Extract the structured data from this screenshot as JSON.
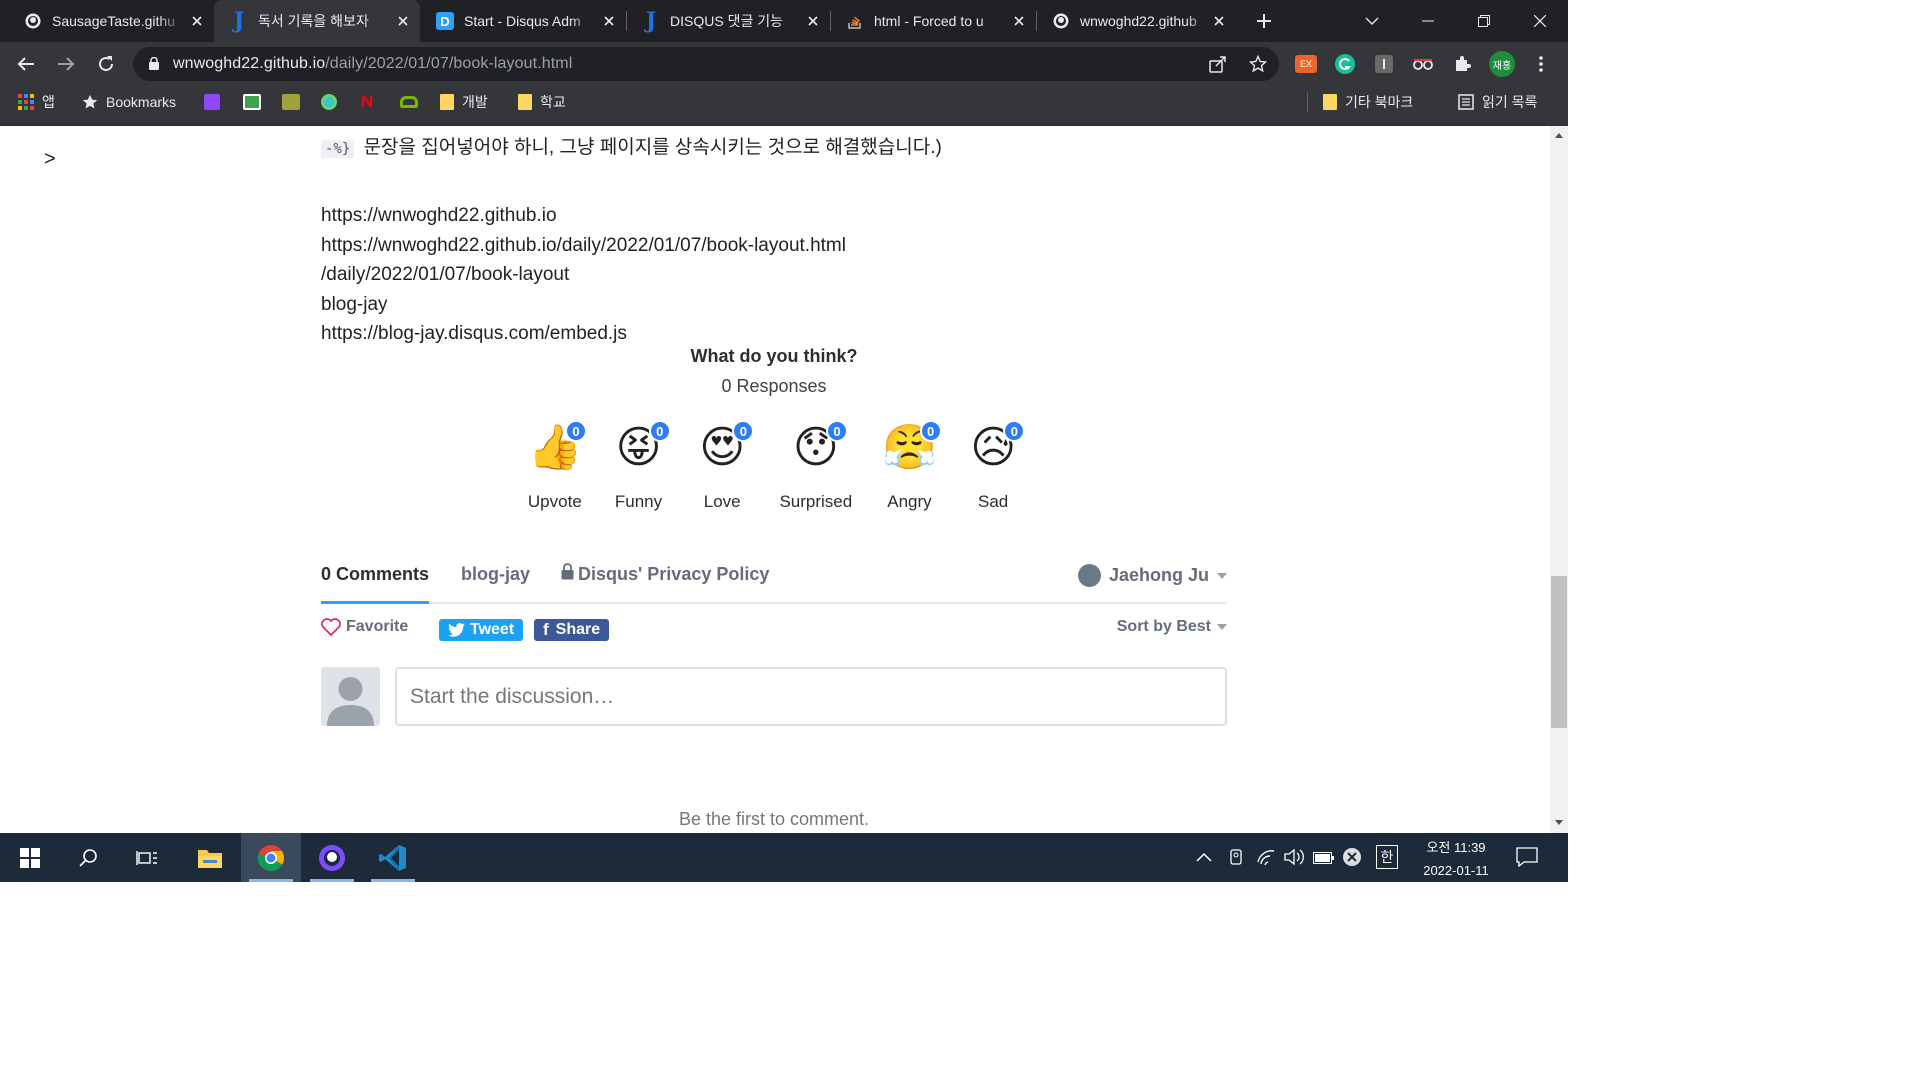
{
  "browser": {
    "tabs": [
      {
        "title": "SausageTaste.githu",
        "icon": "github-icon",
        "active": false
      },
      {
        "title": "독서 기록을 해보자",
        "icon": "jekyll-j-icon",
        "active": true
      },
      {
        "title": "Start - Disqus Adm",
        "icon": "disqus-icon",
        "active": false
      },
      {
        "title": "DISQUS 댓글 기능",
        "icon": "jekyll-j-icon",
        "active": false
      },
      {
        "title": "html - Forced to u",
        "icon": "stackoverflow-icon",
        "active": false
      },
      {
        "title": "wnwoghd22.github",
        "icon": "github-icon",
        "active": false
      }
    ],
    "url_host": "wnwoghd22.github.io",
    "url_path": "/daily/2022/01/07/book-layout.html",
    "profile_label": "재홍",
    "ext_badge": "EX",
    "bookmarks": {
      "apps": "앱",
      "bookmarks": "Bookmarks",
      "folder_dev": "개발",
      "folder_school": "학교",
      "other": "기타 북마크",
      "reading_list": "읽기 목록"
    }
  },
  "page": {
    "side_arrow": ">",
    "code_snippet": "-%}",
    "intro_text": "문장을 집어넣어야 하니, 그냥 페이지를 상속시키는 것으로 해결했습니다.)",
    "lines": [
      "https://wnwoghd22.github.io",
      "https://wnwoghd22.github.io/daily/2022/01/07/book-layout.html",
      "/daily/2022/01/07/book-layout",
      "blog-jay",
      "https://blog-jay.disqus.com/embed.js"
    ]
  },
  "disqus": {
    "question": "What do you think?",
    "responses": "0 Responses",
    "reactions": [
      {
        "label": "Upvote",
        "count": "0",
        "emoji": "👍",
        "icon": "thumbs-up-icon"
      },
      {
        "label": "Funny",
        "count": "0",
        "emoji": "😝",
        "icon": "funny-face-icon"
      },
      {
        "label": "Love",
        "count": "0",
        "emoji": "😍",
        "icon": "heart-eyes-icon"
      },
      {
        "label": "Surprised",
        "count": "0",
        "emoji": "😯",
        "icon": "surprised-face-icon"
      },
      {
        "label": "Angry",
        "count": "0",
        "emoji": "😤",
        "icon": "angry-face-icon"
      },
      {
        "label": "Sad",
        "count": "0",
        "emoji": "😥",
        "icon": "sad-face-icon"
      }
    ],
    "tab_comments": "0 Comments",
    "tab_community": "blog-jay",
    "tab_privacy": "Disqus' Privacy Policy",
    "user_name": "Jaehong Ju",
    "favorite": "Favorite",
    "tweet": "Tweet",
    "share": "Share",
    "sort": "Sort by Best",
    "placeholder": "Start the discussion…",
    "empty_msg": "Be the first to comment.",
    "colors": {
      "accent": "#2e7cf6",
      "twitter": "#1da1f2",
      "facebook": "#3b5998",
      "heart": "#e0245e"
    }
  },
  "taskbar": {
    "time": "오전 11:39",
    "date": "2022-01-11",
    "ime": "한"
  }
}
